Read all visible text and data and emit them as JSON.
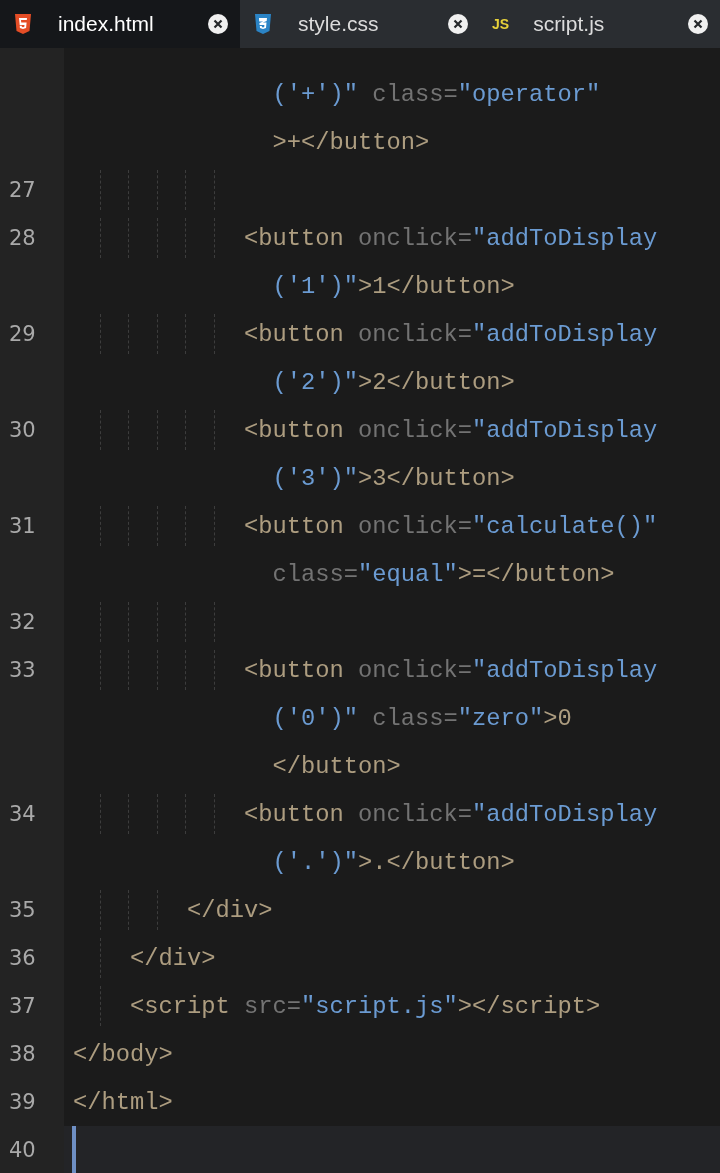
{
  "tabs": [
    {
      "label": "index.html",
      "selected": true,
      "kind": "html"
    },
    {
      "label": "style.css",
      "selected": false,
      "kind": "css"
    },
    {
      "label": "script.js",
      "selected": false,
      "kind": "js",
      "icon_text": "JS"
    }
  ],
  "lines": [
    {
      "active": false,
      "rows": [
        [
          {
            "kind": "string",
            "text": "              ('+')\" "
          },
          {
            "kind": "attr",
            "text": "class="
          },
          {
            "kind": "string",
            "text": "\"operator\""
          }
        ],
        [
          {
            "kind": "tag",
            "text": "              >+</button>"
          }
        ]
      ]
    },
    {
      "number": "27",
      "active": false,
      "rows": [
        [
          {
            "kind": "space",
            "text": "            "
          }
        ]
      ]
    },
    {
      "number": "28",
      "active": false,
      "rows": [
        [
          {
            "kind": "tag",
            "text": "            <button "
          },
          {
            "kind": "attr",
            "text": "onclick="
          },
          {
            "kind": "string",
            "text": "\"addToDisplay"
          }
        ],
        [
          {
            "kind": "string",
            "text": "              ('1')\""
          },
          {
            "kind": "tag",
            "text": ">1</button>"
          }
        ]
      ]
    },
    {
      "number": "29",
      "active": false,
      "rows": [
        [
          {
            "kind": "tag",
            "text": "            <button "
          },
          {
            "kind": "attr",
            "text": "onclick="
          },
          {
            "kind": "string",
            "text": "\"addToDisplay"
          }
        ],
        [
          {
            "kind": "string",
            "text": "              ('2')\""
          },
          {
            "kind": "tag",
            "text": ">2</button>"
          }
        ]
      ]
    },
    {
      "number": "30",
      "active": false,
      "rows": [
        [
          {
            "kind": "tag",
            "text": "            <button "
          },
          {
            "kind": "attr",
            "text": "onclick="
          },
          {
            "kind": "string",
            "text": "\"addToDisplay"
          }
        ],
        [
          {
            "kind": "string",
            "text": "              ('3')\""
          },
          {
            "kind": "tag",
            "text": ">3</button>"
          }
        ]
      ]
    },
    {
      "number": "31",
      "active": false,
      "rows": [
        [
          {
            "kind": "tag",
            "text": "            <button "
          },
          {
            "kind": "attr",
            "text": "onclick="
          },
          {
            "kind": "string",
            "text": "\"calculate()\""
          }
        ],
        [
          {
            "kind": "attr",
            "text": "              class="
          },
          {
            "kind": "string",
            "text": "\"equal\""
          },
          {
            "kind": "tag",
            "text": ">=</button>"
          }
        ]
      ]
    },
    {
      "number": "32",
      "active": false,
      "rows": [
        [
          {
            "kind": "space",
            "text": "            "
          }
        ]
      ]
    },
    {
      "number": "33",
      "active": false,
      "rows": [
        [
          {
            "kind": "tag",
            "text": "            <button "
          },
          {
            "kind": "attr",
            "text": "onclick="
          },
          {
            "kind": "string",
            "text": "\"addToDisplay"
          }
        ],
        [
          {
            "kind": "string",
            "text": "              ('0')\" "
          },
          {
            "kind": "attr",
            "text": "class="
          },
          {
            "kind": "string",
            "text": "\"zero\""
          },
          {
            "kind": "tag",
            "text": ">0"
          }
        ],
        [
          {
            "kind": "tag",
            "text": "              </button>"
          }
        ]
      ]
    },
    {
      "number": "34",
      "active": false,
      "rows": [
        [
          {
            "kind": "tag",
            "text": "            <button "
          },
          {
            "kind": "attr",
            "text": "onclick="
          },
          {
            "kind": "string",
            "text": "\"addToDisplay"
          }
        ],
        [
          {
            "kind": "string",
            "text": "              ('.')\""
          },
          {
            "kind": "tag",
            "text": ">.</button>"
          }
        ]
      ]
    },
    {
      "number": "35",
      "active": false,
      "rows": [
        [
          {
            "kind": "tag",
            "text": "        </div>"
          }
        ]
      ]
    },
    {
      "number": "36",
      "active": false,
      "rows": [
        [
          {
            "kind": "tag",
            "text": "    </div>"
          }
        ]
      ]
    },
    {
      "number": "37",
      "active": false,
      "rows": [
        [
          {
            "kind": "tag",
            "text": "    <script "
          },
          {
            "kind": "attr",
            "text": "src="
          },
          {
            "kind": "string",
            "text": "\"script.js\""
          },
          {
            "kind": "tag",
            "text": "></script>"
          }
        ]
      ]
    },
    {
      "number": "38",
      "active": false,
      "rows": [
        [
          {
            "kind": "tag",
            "text": "</body>"
          }
        ]
      ]
    },
    {
      "number": "39",
      "active": false,
      "rows": [
        [
          {
            "kind": "tag",
            "text": "</html>"
          }
        ]
      ]
    },
    {
      "number": "40",
      "active": true,
      "rows": [
        []
      ]
    }
  ]
}
